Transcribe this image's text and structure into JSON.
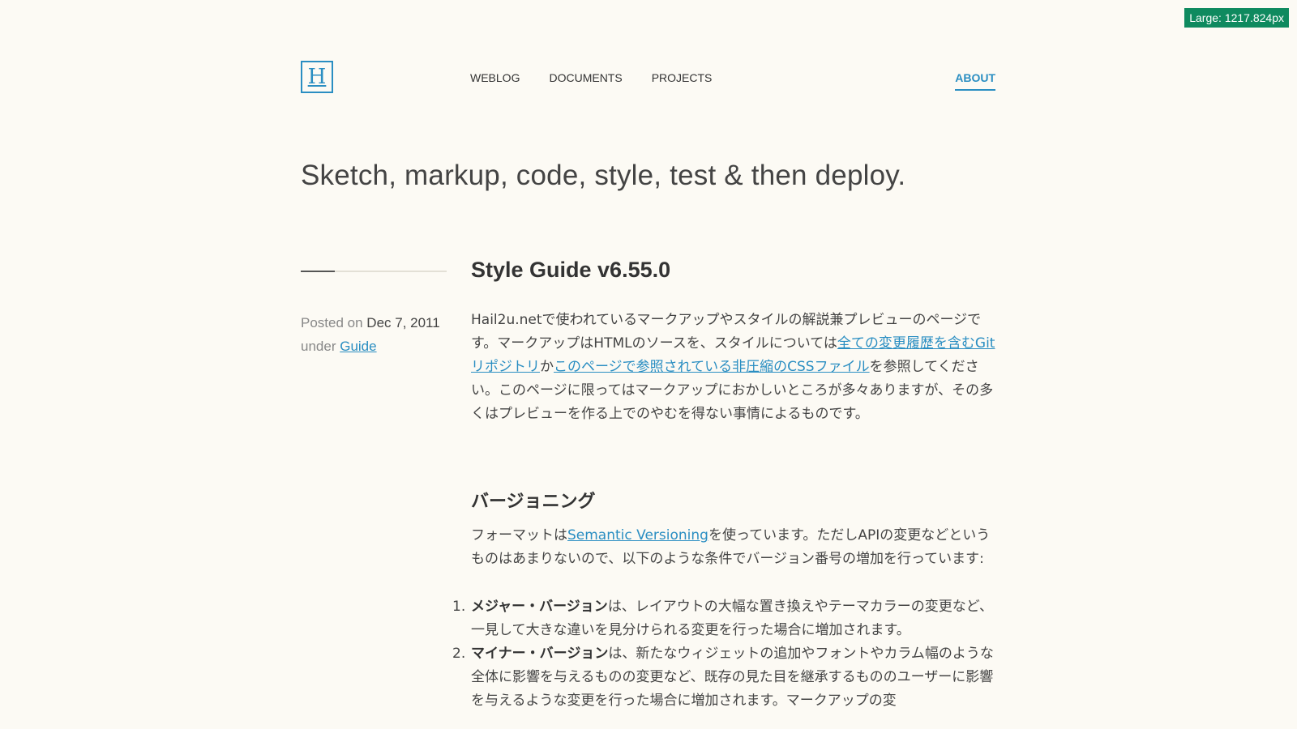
{
  "badge": "Large: 1217.824px",
  "header": {
    "logo_letter": "H",
    "nav": [
      "WEBLOG",
      "DOCUMENTS",
      "PROJECTS"
    ],
    "about": "ABOUT"
  },
  "tagline": "Sketch, markup, code, style, test & then deploy.",
  "meta": {
    "posted_on": "Posted on",
    "date": "Dec 7, 2011",
    "under": "under",
    "category": "Guide"
  },
  "post": {
    "title": "Style Guide v6.55.0",
    "intro": {
      "t1": "Hail2u.netで使われているマークアップやスタイルの解説兼プレビューのページです。マークアップはHTMLのソースを、スタイルについては",
      "link1": "全ての変更履歴を含むGitリポジトリ",
      "t2": "か",
      "link2": "このページで参照されている非圧縮のCSSファイル",
      "t3": "を参照してください。このページに限ってはマークアップにおかしいところが多々ありますが、その多くはプレビューを作る上でのやむを得ない事情によるものです。"
    },
    "versioning": {
      "heading": "バージョニング",
      "p1": "フォーマットは",
      "link": "Semantic Versioning",
      "p2": "を使っています。ただしAPIの変更などというものはあまりないので、以下のような条件でバージョン番号の増加を行っています:",
      "items": [
        {
          "num": "1.",
          "bold": "メジャー・バージョン",
          "text": "は、レイアウトの大幅な置き換えやテーマカラーの変更など、一見して大きな違いを見分けられる変更を行った場合に増加されます。"
        },
        {
          "num": "2.",
          "bold": "マイナー・バージョン",
          "text": "は、新たなウィジェットの追加やフォントやカラム幅のような全体に影響を与えるものの変更など、既存の見た目を継承するもののユーザーに影響を与えるような変更を行った場合に増加されます。マークアップの変"
        }
      ]
    }
  }
}
